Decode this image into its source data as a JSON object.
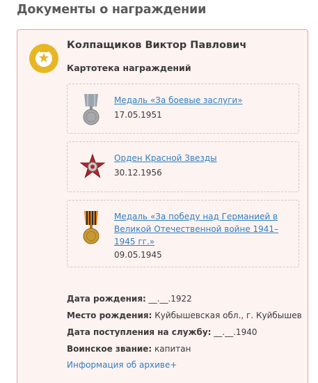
{
  "page": {
    "heading": "Документы о награждении"
  },
  "person": {
    "name": "Колпащиков Виктор Павлович"
  },
  "section_title": "Картотека награждений",
  "awards": [
    {
      "name": "Медаль «За боевые заслуги»",
      "date": "17.05.1951",
      "icon": "medal-combat-merit-icon"
    },
    {
      "name": "Орден Красной Звезды",
      "date": "30.12.1956",
      "icon": "order-red-star-icon"
    },
    {
      "name": "Медаль «За победу над Германией в Великой Отечественной войне 1941–1945 гг.»",
      "date": "09.05.1945",
      "icon": "medal-victory-germany-icon"
    }
  ],
  "info": {
    "birth_date_label": "Дата рождения:",
    "birth_date_value": " __.__.1922",
    "birth_place_label": "Место рождения:",
    "birth_place_value": " Куйбышевская обл., г. Куйбышев",
    "service_start_label": "Дата поступления на службу:",
    "service_start_value": " __.__.1940",
    "rank_label": "Воинское звание:",
    "rank_value": " капитан"
  },
  "archive_link": "Информация об архиве+",
  "colors": {
    "accent_gold": "#e7b622",
    "link": "#2f7fc4",
    "card_border": "#e8a3a0",
    "card_bg": "#fdf3f1"
  }
}
